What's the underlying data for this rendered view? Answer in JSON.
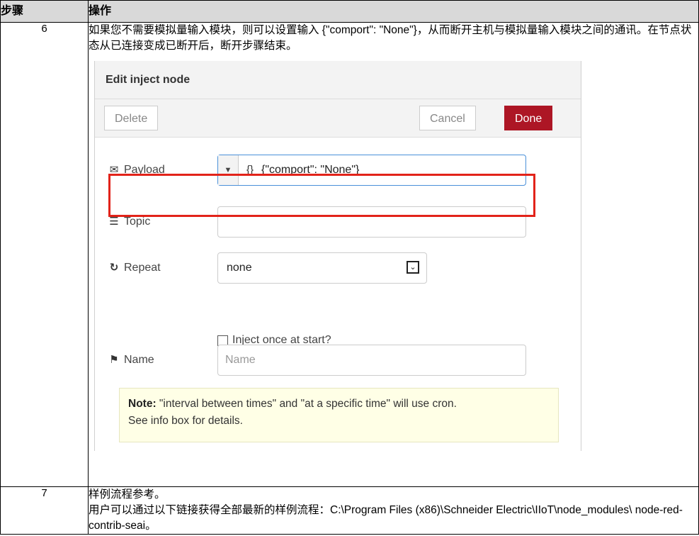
{
  "table": {
    "headers": [
      "步骤",
      "操作"
    ],
    "rows": [
      {
        "step": "6",
        "text": "如果您不需要模拟量输入模块，则可以设置输入 {\"comport\": \"None\"}，从而断开主机与模拟量输入模块之间的通讯。在节点状态从已连接变成已断开后，断开步骤结束。"
      },
      {
        "step": "7",
        "line1": "样例流程参考。",
        "line2": "用户可以通过以下链接获得全部最新的样例流程：C:\\Program Files (x86)\\Schneider Electric\\IIoT\\node_modules\\ node-red-contrib-seai。"
      }
    ]
  },
  "dialog": {
    "title": "Edit inject node",
    "buttons": {
      "delete": "Delete",
      "cancel": "Cancel",
      "done": "Done"
    },
    "fields": {
      "payload": {
        "label": "Payload",
        "type": "{}",
        "value": "{\"comport\": \"None\"}",
        "icon": "envelope-icon"
      },
      "topic": {
        "label": "Topic",
        "value": "",
        "icon": "list-icon"
      },
      "repeat": {
        "label": "Repeat",
        "value": "none",
        "icon": "refresh-icon"
      },
      "inject_once": {
        "label": "Inject once at start?",
        "checked": false
      },
      "name": {
        "label": "Name",
        "placeholder": "Name",
        "icon": "tag-icon"
      }
    },
    "note": {
      "bold": "Note:",
      "text": " \"interval between times\" and \"at a specific time\" will use cron.",
      "text2": "See info box for details."
    },
    "accent_colors": {
      "done": "#ad1625",
      "highlight": "#e2231a"
    }
  }
}
